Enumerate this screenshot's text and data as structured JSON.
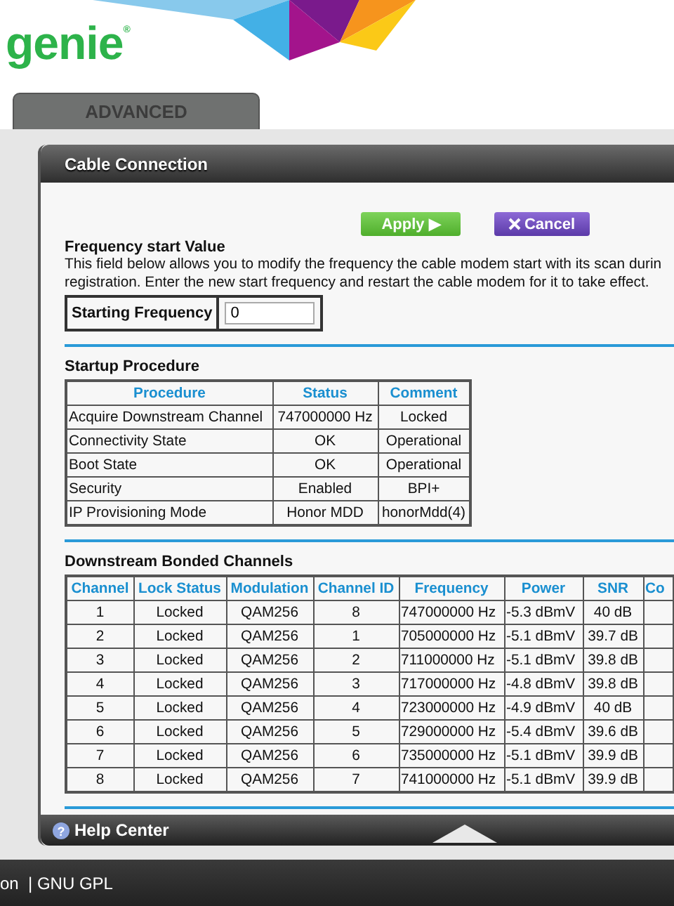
{
  "logo": {
    "text": "genie",
    "mark": "®"
  },
  "tabs": [
    {
      "label": "ADVANCED",
      "selected": false
    }
  ],
  "panel": {
    "title": "Cable Connection",
    "buttons": [
      {
        "kind": "apply",
        "label": "Apply ▶"
      },
      {
        "kind": "cancel",
        "label": "Cancel"
      }
    ],
    "frequency": {
      "heading": "Frequency start Value",
      "description": [
        "This field below allows you to modify the frequency the cable modem start with its scan durin",
        "registration. Enter the new start frequency and restart the cable modem for it to take effect."
      ],
      "label": "Starting Frequency",
      "value": "0"
    },
    "startup": {
      "heading": "Startup Procedure",
      "columns": [
        "Procedure",
        "Status",
        "Comment"
      ],
      "rows": [
        [
          "Acquire Downstream Channel",
          "747000000 Hz",
          "Locked"
        ],
        [
          "Connectivity State",
          "OK",
          "Operational"
        ],
        [
          "Boot State",
          "OK",
          "Operational"
        ],
        [
          "Security",
          "Enabled",
          "BPI+"
        ],
        [
          "IP Provisioning Mode",
          "Honor MDD",
          "honorMdd(4)"
        ]
      ]
    },
    "downstream": {
      "heading": "Downstream Bonded Channels",
      "columns": [
        "Channel",
        "Lock Status",
        "Modulation",
        "Channel ID",
        "Frequency",
        "Power",
        "SNR",
        "Co"
      ],
      "rows": [
        [
          "1",
          "Locked",
          "QAM256",
          "8",
          "747000000 Hz",
          "-5.3 dBmV",
          "40 dB",
          ""
        ],
        [
          "2",
          "Locked",
          "QAM256",
          "1",
          "705000000 Hz",
          "-5.1 dBmV",
          "39.7 dB",
          ""
        ],
        [
          "3",
          "Locked",
          "QAM256",
          "2",
          "711000000 Hz",
          "-5.1 dBmV",
          "39.8 dB",
          ""
        ],
        [
          "4",
          "Locked",
          "QAM256",
          "3",
          "717000000 Hz",
          "-4.8 dBmV",
          "39.8 dB",
          ""
        ],
        [
          "5",
          "Locked",
          "QAM256",
          "4",
          "723000000 Hz",
          "-4.9 dBmV",
          "40 dB",
          ""
        ],
        [
          "6",
          "Locked",
          "QAM256",
          "5",
          "729000000 Hz",
          "-5.4 dBmV",
          "39.6 dB",
          ""
        ],
        [
          "7",
          "Locked",
          "QAM256",
          "6",
          "735000000 Hz",
          "-5.1 dBmV",
          "39.9 dB",
          ""
        ],
        [
          "8",
          "Locked",
          "QAM256",
          "7",
          "741000000 Hz",
          "-5.1 dBmV",
          "39.9 dB",
          ""
        ]
      ]
    },
    "help": "Help Center",
    "help_icon": "?"
  },
  "footer": "on  | GNU GPL"
}
